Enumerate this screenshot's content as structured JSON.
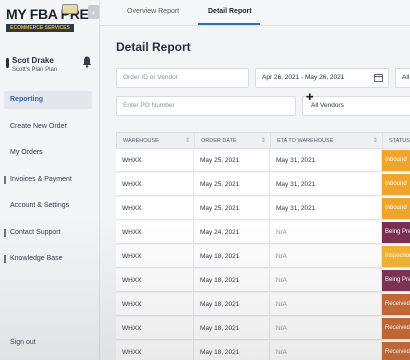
{
  "brand": {
    "logo_title": "MY FBA PREP",
    "logo_subtitle": "ECOMMERCE SERVICES"
  },
  "user": {
    "name": "Scot Drake",
    "plan": "Scott's Plan Plan"
  },
  "sidebar": {
    "items": [
      {
        "label": "Reporting",
        "active": true
      },
      {
        "label": "Create New Order",
        "active": false
      },
      {
        "label": "My Orders",
        "active": false
      },
      {
        "label": "Invoices & Payment",
        "active": false
      },
      {
        "label": "Account & Settings",
        "active": false
      },
      {
        "label": "Contact Support",
        "active": false
      },
      {
        "label": "Knowledge Base",
        "active": false
      }
    ],
    "sign_out": "Sign out"
  },
  "tabs": [
    {
      "label": "Overview Report",
      "active": false
    },
    {
      "label": "Detail Report",
      "active": true
    }
  ],
  "page": {
    "title": "Detail Report"
  },
  "filters": {
    "search_placeholder": "Order ID or Vendor",
    "date_range": "Apr 26, 2021 - May 26, 2021",
    "third_dropdown": "All",
    "po_placeholder": "Enter PO Number",
    "vendor_select": "All Vendors"
  },
  "table": {
    "headers": [
      "WAREHOUSE",
      "ORDER DATE",
      "ETA TO WAREHOUSE",
      "STATUS"
    ],
    "rows": [
      {
        "warehouse": "WHXX",
        "order_date": "May 25, 2021",
        "eta": "May 31, 2021",
        "status": "Inbound",
        "status_color": "#f0a42a"
      },
      {
        "warehouse": "WHXX",
        "order_date": "May 25, 2021",
        "eta": "May 31, 2021",
        "status": "Inbound",
        "status_color": "#f0a42a"
      },
      {
        "warehouse": "WHXX",
        "order_date": "May 25, 2021",
        "eta": "May 31, 2021",
        "status": "Inbound",
        "status_color": "#f0a42a"
      },
      {
        "warehouse": "WHXX",
        "order_date": "May 24, 2021",
        "eta": "N/A",
        "status": "Being Prepped",
        "status_color": "#7a2f4f"
      },
      {
        "warehouse": "WHXX",
        "order_date": "May 18, 2021",
        "eta": "N/A",
        "status": "Inspection",
        "status_color": "#f4b233"
      },
      {
        "warehouse": "WHXX",
        "order_date": "May 18, 2021",
        "eta": "N/A",
        "status": "Being Prepped",
        "status_color": "#7a2f4f"
      },
      {
        "warehouse": "WHXX",
        "order_date": "May 18, 2021",
        "eta": "N/A",
        "status": "Received",
        "status_color": "#c9642c"
      },
      {
        "warehouse": "WHXX",
        "order_date": "May 18, 2021",
        "eta": "N/A",
        "status": "Received",
        "status_color": "#c9642c"
      },
      {
        "warehouse": "WHXX",
        "order_date": "May 18, 2021",
        "eta": "N/A",
        "status": "Received",
        "status_color": "#c9642c"
      }
    ]
  },
  "colors": {
    "accent": "#2f6fb8",
    "logo_band": "#2a3b47",
    "logo_text": "#f2b23a"
  }
}
